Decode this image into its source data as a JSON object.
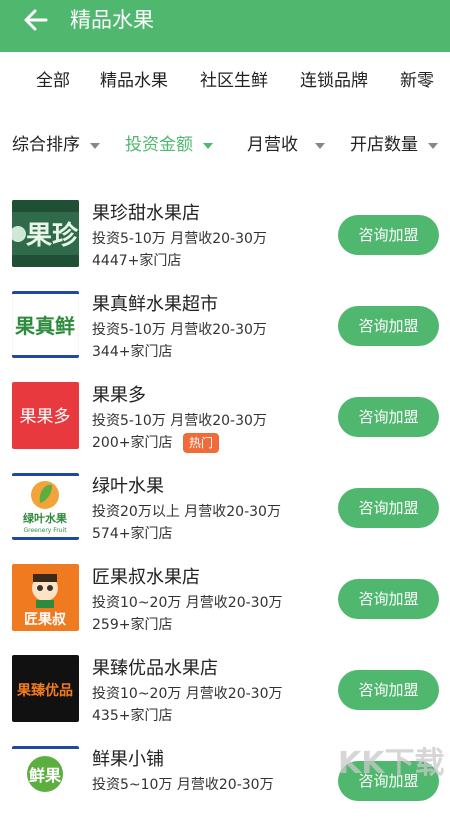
{
  "header": {
    "title": "精品水果"
  },
  "categories": [
    "全部",
    "精品水果",
    "社区生鲜",
    "连锁品牌",
    "新零"
  ],
  "filters": [
    "综合排序",
    "投资金额",
    "月营收",
    "开店数量"
  ],
  "active_filter": "投资金额",
  "accent_color": "#4fb86e",
  "list": [
    {
      "name": "果珍甜水果店",
      "info": "投资5-10万  月营收20-30万",
      "stores": "4447+家门店",
      "button": "咨询加盟"
    },
    {
      "name": "果真鲜水果超市",
      "info": "投资5-10万  月营收20-30万",
      "stores": "344+家门店",
      "button": "咨询加盟"
    },
    {
      "name": "果果多",
      "info": "投资5-10万  月营收20-30万",
      "stores": "200+家门店",
      "badge": "热门",
      "button": "咨询加盟"
    },
    {
      "name": "绿叶水果",
      "info": "投资20万以上  月营收20-30万",
      "stores": "574+家门店",
      "button": "咨询加盟"
    },
    {
      "name": "匠果叔水果店",
      "info": "投资10~20万  月营收20-30万",
      "stores": "259+家门店",
      "button": "咨询加盟"
    },
    {
      "name": "果臻优品水果店",
      "info": "投资10~20万  月营收20-30万",
      "stores": "435+家门店",
      "button": "咨询加盟"
    },
    {
      "name": "鲜果小铺",
      "info": "投资5~10万  月营收20-30万",
      "stores": "",
      "button": "咨询加盟"
    }
  ],
  "logos": {
    "logo1": "果珍",
    "logo2": "果真鲜",
    "logo3": "果果多",
    "logo4_main": "绿叶水果",
    "logo4_sub": "Greenery Fruit",
    "logo5": "匠果叔",
    "logo6": "果臻优品",
    "logo7": "鲜果"
  },
  "watermark": "KK下载"
}
